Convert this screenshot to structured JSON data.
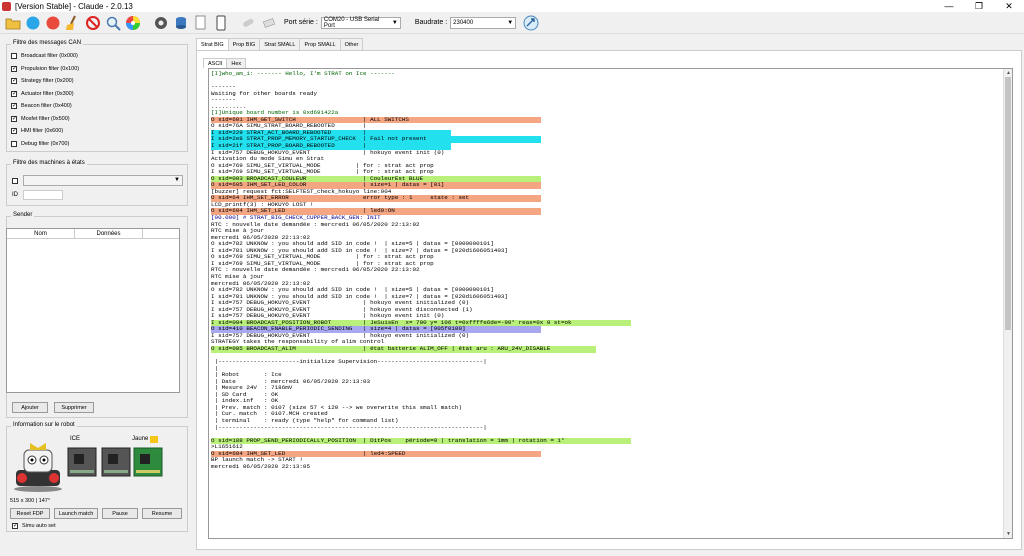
{
  "window": {
    "title": "[Version Stable] - Claude - 2.0.13",
    "minimize": "—",
    "maximize": "❐",
    "close": "✕"
  },
  "toolbar": {
    "port_label": "Port série :",
    "port_value": "COM20 - USB Serial Port",
    "baud_label": "Baudrate :",
    "baud_value": "230400"
  },
  "can_filter": {
    "title": "Filtre des messages CAN",
    "items": [
      {
        "label": "Broadcast filter (0x000)",
        "checked": false
      },
      {
        "label": "Propulsion filter (0x100)",
        "checked": true
      },
      {
        "label": "Strategy filter (0x200)",
        "checked": true
      },
      {
        "label": "Actuator filter (0x300)",
        "checked": true
      },
      {
        "label": "Beacon filter (0x400)",
        "checked": true
      },
      {
        "label": "Mosfet filter (0x500)",
        "checked": true
      },
      {
        "label": "HMI filter (0x600)",
        "checked": true
      },
      {
        "label": "Debug filter (0x700)",
        "checked": false
      }
    ]
  },
  "state_filter": {
    "title": "Filtre des machines à états",
    "id_label": "ID"
  },
  "sender": {
    "title": "Sender",
    "col_nom": "Nom",
    "col_donnees": "Données",
    "add_button": "Ajouter",
    "remove_button": "Supprimer"
  },
  "robot_info": {
    "title": "Information sur le robot",
    "ice_label": "ICE",
    "jaune_label": "Jaune",
    "jaune_color": "#f5c518",
    "pos_text": "515 x 300  |  147°",
    "reset_button": "Reset FDP",
    "launch_button": "Launch match",
    "pause_button": "Pause",
    "resume_button": "Resume",
    "simu_label": "Simu auto set",
    "simu_checked": true
  },
  "tabs": [
    "Strat BIG",
    "Prop BIG",
    "Strat SMALL",
    "Prop SMALL",
    "Other"
  ],
  "subtabs": [
    "ASCII",
    "Hex"
  ],
  "console": {
    "lines": [
      {
        "t": "[I]who_am_i: ------- Hello, I'm STRAT on Ice -------",
        "c": "#006400",
        "bg": ""
      },
      {
        "t": "",
        "c": "#000",
        "bg": ""
      },
      {
        "t": "-------",
        "c": "#000",
        "bg": ""
      },
      {
        "t": "Waiting for other boards ready",
        "c": "#000",
        "bg": ""
      },
      {
        "t": "-------",
        "c": "#000",
        "bg": ""
      },
      {
        "t": "..........",
        "c": "#000",
        "bg": ""
      },
      {
        "t": "[I]Unique board number is 0xd691422a",
        "c": "#006400",
        "bg": ""
      },
      {
        "t": "O sid=601 IHM_GET_SWITCH                   | ALL SWITCHS",
        "c": "#000",
        "bg": "#f4a582",
        "w": 330
      },
      {
        "t": "O sid=76A SIMU_STRAT_BOARD_REBOOTED        |",
        "c": "#000",
        "bg": ""
      },
      {
        "t": "I sid=229 STRAT_ACT_BOARD_REBOOTED         |",
        "c": "#000",
        "bg": "#22e0ee",
        "w": 240
      },
      {
        "t": "I sid=2e8 STRAT_PROP_MEMORY_STARTUP_CHECK  | Fail not present",
        "c": "#000",
        "bg": "#22e0ee",
        "w": 330
      },
      {
        "t": "I sid=21f STRAT_PROP_BOARD_REBOOTED        |",
        "c": "#000",
        "bg": "#22e0ee",
        "w": 240
      },
      {
        "t": "I sid=757 DEBUG_HOKUYO_EVENT               | hokuyo event init (0)",
        "c": "#000",
        "bg": ""
      },
      {
        "t": "Activation du mode Simu en Strat",
        "c": "#000",
        "bg": ""
      },
      {
        "t": "O sid=769 SIMU_SET_VIRTUAL_MODE          | for : strat act prop",
        "c": "#000",
        "bg": ""
      },
      {
        "t": "I sid=769 SIMU_SET_VIRTUAL_MODE          | for : strat act prop",
        "c": "#000",
        "bg": ""
      },
      {
        "t": "O sid=003 BROADCAST_COULEUR                | CouleurEst BLUE",
        "c": "#000",
        "bg": "#b8f07a",
        "w": 330
      },
      {
        "t": "O sid=605 IHM_SET_LED_COLOR                | size=1 | datas = [01]",
        "c": "#000",
        "bg": "#f4a582",
        "w": 330
      },
      {
        "t": "[buzzer] request fct:SELFTEST_check_hokuyo line:904",
        "c": "#000",
        "bg": ""
      },
      {
        "t": "O sid=64 IHM_SET_ERROR                     error type : 1     state : set",
        "c": "#000",
        "bg": "#f4a582",
        "w": 330
      },
      {
        "t": "LCD_printf(3) : HOKUYO LOST !",
        "c": "#000",
        "bg": ""
      },
      {
        "t": "O sid=604 IHM_SET_LED                      | led9:ON",
        "c": "#000",
        "bg": "#f4a582",
        "w": 330
      },
      {
        "t": "[00.000] # STRAT_BIG_CHECK_CUPPER_BACK_GEN: INIT",
        "c": "#00008b",
        "bg": ""
      },
      {
        "t": "RTC : nouvelle date demandée : mercredi 06/05/2020 22:13:02",
        "c": "#000",
        "bg": ""
      },
      {
        "t": "RTC mise à jour",
        "c": "#000",
        "bg": ""
      },
      {
        "t": "mercredi 06/05/2020 22:13:02",
        "c": "#000",
        "bg": ""
      },
      {
        "t": "O sid=782 UNKNOW : you should add SID in code !  | size=5 | datas = [0000000101]",
        "c": "#000",
        "bg": ""
      },
      {
        "t": "I sid=781 UNKNOW : you should add SID in code !  | size=7 | datas = [020d1606051403]",
        "c": "#000",
        "bg": ""
      },
      {
        "t": "O sid=769 SIMU_SET_VIRTUAL_MODE          | for : strat act prop",
        "c": "#000",
        "bg": ""
      },
      {
        "t": "I sid=769 SIMU_SET_VIRTUAL_MODE          | for : strat act prop",
        "c": "#000",
        "bg": ""
      },
      {
        "t": "RTC : nouvelle date demandée : mercredi 06/05/2020 22:13:02",
        "c": "#000",
        "bg": ""
      },
      {
        "t": "RTC mise à jour",
        "c": "#000",
        "bg": ""
      },
      {
        "t": "mercredi 06/05/2020 22:13:02",
        "c": "#000",
        "bg": ""
      },
      {
        "t": "O sid=782 UNKNOW : you should add SID in code !  | size=5 | datas = [0000000101]",
        "c": "#000",
        "bg": ""
      },
      {
        "t": "I sid=781 UNKNOW : you should add SID in code !  | size=7 | datas = [020d1606051403]",
        "c": "#000",
        "bg": ""
      },
      {
        "t": "I sid=757 DEBUG_HOKUYO_EVENT               | hokuyo event initialized (0)",
        "c": "#000",
        "bg": ""
      },
      {
        "t": "I sid=757 DEBUG_HOKUYO_EVENT               | hokuyo event disconnected (1)",
        "c": "#000",
        "bg": ""
      },
      {
        "t": "I sid=757 DEBUG_HOKUYO_EVENT               | hokuyo event init (0)",
        "c": "#000",
        "bg": ""
      },
      {
        "t": "I sid=004 BROADCAST_POSITION_ROBOT         | JeSuisEn  x= 700 y= 106 t=0xffffe6de=-90° reas=0x 0 st=ok",
        "c": "#000",
        "bg": "#b8f07a",
        "w": 420
      },
      {
        "t": "O sid=410 BEACON_ENABLE_PERIODIC_SENDING   | size=4 | datas = [905f0100]",
        "c": "#000",
        "bg": "#a8a8f0",
        "w": 330
      },
      {
        "t": "I sid=757 DEBUG_HOKUYO_EVENT               | hokuyo event initialized (0)",
        "c": "#000",
        "bg": ""
      },
      {
        "t": "STRATEGY takes the responsability of alim control",
        "c": "#000",
        "bg": ""
      },
      {
        "t": "O sid=005 BROADCAST_ALIM                   | état batterie ALIM_OFF | état aru : ARU_24V_DISABLE",
        "c": "#000",
        "bg": "#b8f07a",
        "w": 385
      },
      {
        "t": "",
        "c": "#000",
        "bg": ""
      },
      {
        "t": " |-----------------------initialize Supervision------------------------------|",
        "c": "#000",
        "bg": ""
      },
      {
        "t": " |",
        "c": "#000",
        "bg": ""
      },
      {
        "t": " | Robot       : Ice",
        "c": "#000",
        "bg": ""
      },
      {
        "t": " | Date        : mercredi 06/05/2020 22:13:03",
        "c": "#000",
        "bg": ""
      },
      {
        "t": " | Mesure 24V  : 7186mV",
        "c": "#000",
        "bg": ""
      },
      {
        "t": " | SD Card     : OK",
        "c": "#000",
        "bg": ""
      },
      {
        "t": " | index.inf   : OK",
        "c": "#000",
        "bg": ""
      },
      {
        "t": " | Prev. match : 0107 (size 57 < 120 --> we overwrite this small match)",
        "c": "#000",
        "bg": ""
      },
      {
        "t": " | Cur. match  : 0107.MCH created",
        "c": "#000",
        "bg": ""
      },
      {
        "t": " | terminal    : ready (type \"help\" for command list)",
        "c": "#000",
        "bg": ""
      },
      {
        "t": " |---------------------------------------------------------------------------|",
        "c": "#000",
        "bg": ""
      },
      {
        "t": "",
        "c": "#000",
        "bg": ""
      },
      {
        "t": "O sid=188 PROP_SEND_PERIODICALLY_POSITION  | DitPos    période=0 | translation = 1mm | rotation = 1°",
        "c": "#000",
        "bg": "#b8f07a",
        "w": 420
      },
      {
        "t": ">L1651612",
        "c": "#000",
        "bg": ""
      },
      {
        "t": "O sid=604 IHM_SET_LED                      | led4:SPEED",
        "c": "#000",
        "bg": "#f4a582",
        "w": 330
      },
      {
        "t": "BP launch match -> START !",
        "c": "#000",
        "bg": ""
      },
      {
        "t": "mercredi 06/05/2020 22:13:05",
        "c": "#000",
        "bg": ""
      }
    ]
  }
}
